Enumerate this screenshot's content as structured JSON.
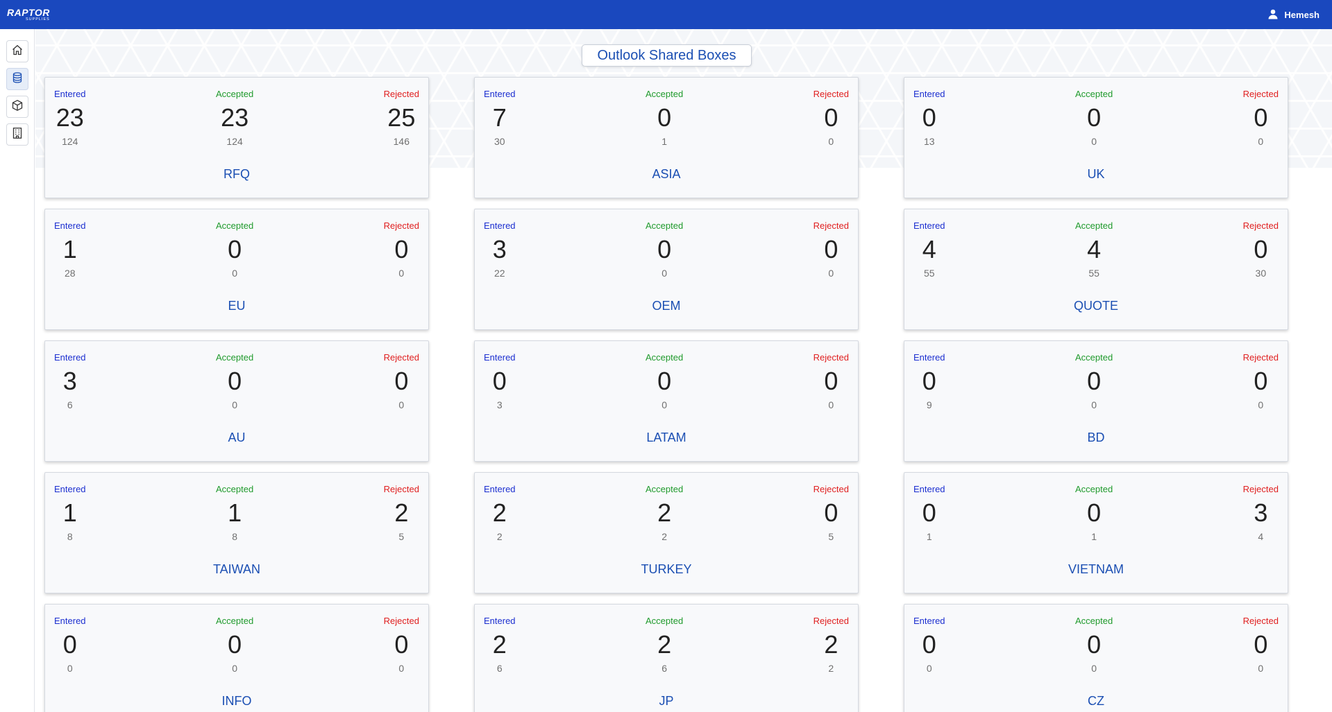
{
  "app": {
    "logo_text": "RAPTOR",
    "logo_sub": "SUPPLIES",
    "user_name": "Hemesh"
  },
  "page_title": "Outlook Shared Boxes",
  "labels": {
    "entered": "Entered",
    "accepted": "Accepted",
    "rejected": "Rejected"
  },
  "sidebar": {
    "items": [
      {
        "name": "home",
        "icon": "home-icon",
        "active": false
      },
      {
        "name": "database",
        "icon": "database-icon",
        "active": true
      },
      {
        "name": "box",
        "icon": "box-icon",
        "active": false
      },
      {
        "name": "building",
        "icon": "building-icon",
        "active": false
      }
    ]
  },
  "cards": [
    {
      "name": "RFQ",
      "entered": "23",
      "entered_total": "124",
      "accepted": "23",
      "accepted_total": "124",
      "rejected": "25",
      "rejected_total": "146"
    },
    {
      "name": "ASIA",
      "entered": "7",
      "entered_total": "30",
      "accepted": "0",
      "accepted_total": "1",
      "rejected": "0",
      "rejected_total": "0"
    },
    {
      "name": "UK",
      "entered": "0",
      "entered_total": "13",
      "accepted": "0",
      "accepted_total": "0",
      "rejected": "0",
      "rejected_total": "0"
    },
    {
      "name": "EU",
      "entered": "1",
      "entered_total": "28",
      "accepted": "0",
      "accepted_total": "0",
      "rejected": "0",
      "rejected_total": "0"
    },
    {
      "name": "OEM",
      "entered": "3",
      "entered_total": "22",
      "accepted": "0",
      "accepted_total": "0",
      "rejected": "0",
      "rejected_total": "0"
    },
    {
      "name": "QUOTE",
      "entered": "4",
      "entered_total": "55",
      "accepted": "4",
      "accepted_total": "55",
      "rejected": "0",
      "rejected_total": "30"
    },
    {
      "name": "AU",
      "entered": "3",
      "entered_total": "6",
      "accepted": "0",
      "accepted_total": "0",
      "rejected": "0",
      "rejected_total": "0"
    },
    {
      "name": "LATAM",
      "entered": "0",
      "entered_total": "3",
      "accepted": "0",
      "accepted_total": "0",
      "rejected": "0",
      "rejected_total": "0"
    },
    {
      "name": "BD",
      "entered": "0",
      "entered_total": "9",
      "accepted": "0",
      "accepted_total": "0",
      "rejected": "0",
      "rejected_total": "0"
    },
    {
      "name": "TAIWAN",
      "entered": "1",
      "entered_total": "8",
      "accepted": "1",
      "accepted_total": "8",
      "rejected": "2",
      "rejected_total": "5"
    },
    {
      "name": "TURKEY",
      "entered": "2",
      "entered_total": "2",
      "accepted": "2",
      "accepted_total": "2",
      "rejected": "0",
      "rejected_total": "5"
    },
    {
      "name": "VIETNAM",
      "entered": "0",
      "entered_total": "1",
      "accepted": "0",
      "accepted_total": "1",
      "rejected": "3",
      "rejected_total": "4"
    },
    {
      "name": "INFO",
      "entered": "0",
      "entered_total": "0",
      "accepted": "0",
      "accepted_total": "0",
      "rejected": "0",
      "rejected_total": "0"
    },
    {
      "name": "JP",
      "entered": "2",
      "entered_total": "6",
      "accepted": "2",
      "accepted_total": "6",
      "rejected": "2",
      "rejected_total": "2"
    },
    {
      "name": "CZ",
      "entered": "0",
      "entered_total": "0",
      "accepted": "0",
      "accepted_total": "0",
      "rejected": "0",
      "rejected_total": "0"
    }
  ],
  "colors": {
    "topbar": "#1a48be",
    "title_text": "#1b4fb3",
    "entered": "#1c2fd0",
    "accepted": "#1f9a2c",
    "rejected": "#e01f1f"
  }
}
